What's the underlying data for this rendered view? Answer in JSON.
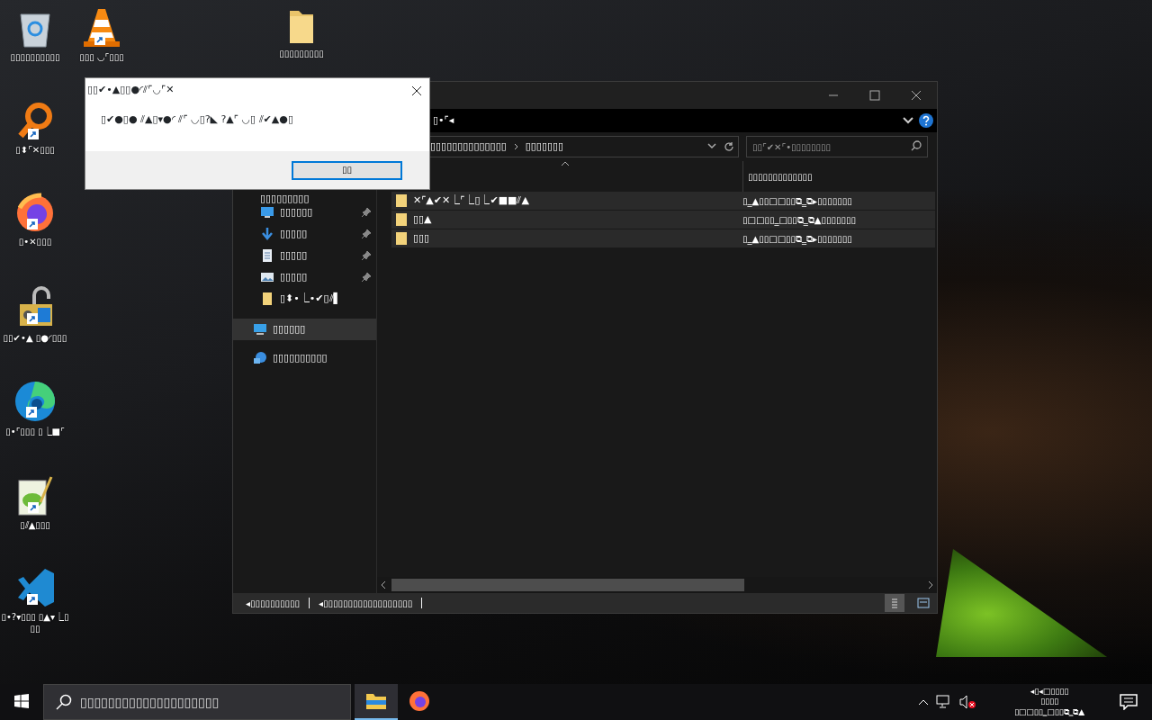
{
  "desktop_icons": [
    {
      "label": "▯▯▯▯▯▯▯▯▯▯",
      "kind": "recycle",
      "shortcut": false
    },
    {
      "label": "▯▯▯ ◡⌜▯▯▯",
      "kind": "cone",
      "shortcut": true
    },
    {
      "label": "▯▯▯▯▯▯▯▯▯",
      "kind": "folder",
      "shortcut": false
    },
    {
      "label": "▯⬍⌜✕▯▯▯",
      "kind": "magnifier",
      "shortcut": true
    },
    {
      "label": "▯•✕▯▯▯",
      "kind": "firefox",
      "shortcut": true
    },
    {
      "label": "▯▯✔•▲ ▯●◜▯▯▯",
      "kind": "lock",
      "shortcut": true
    },
    {
      "label": "▯•⌜▯▯▯ ▯⎿■⌜",
      "kind": "edge",
      "shortcut": true
    },
    {
      "label": "▯⫽▲▯▯▯",
      "kind": "notepad",
      "shortcut": true
    },
    {
      "label": "▯•?▾▯▯▯ ▯▲▾⎿▯▯▯",
      "kind": "vscode",
      "shortcut": true
    }
  ],
  "dialog": {
    "title": "▯▯✔•▲▯▯●◜⫽⌜◡⌜✕",
    "message": "▯✔●▯● ⫽▲▯▾●◜ ⫽⌜ ◡▯?◣ ?▲⌜ ◡▯ ⫽✔▲●▯",
    "button": "▯▯"
  },
  "explorer": {
    "ribbon_tab": "▯•⌜◂",
    "breadcrumb": [
      "▯▯▯▯▯▯▯▯▯▯▯▯▯▯",
      "▯▯▯▯▯▯▯"
    ],
    "search": {
      "placeholder": "▯▯⌜✔✕⌜•▯▯▯▯▯▯▯▯"
    },
    "nav_items": [
      {
        "label": "▯▯▯▯▯▯▯▯▯",
        "kind": "hidden",
        "pinned": false,
        "selected": false
      },
      {
        "label": "▯▯▯▯▯▯",
        "kind": "desktop",
        "pinned": true,
        "selected": false
      },
      {
        "label": "▯▯▯▯▯",
        "kind": "download",
        "pinned": true,
        "selected": false
      },
      {
        "label": "▯▯▯▯▯",
        "kind": "document",
        "pinned": true,
        "selected": false
      },
      {
        "label": "▯▯▯▯▯",
        "kind": "picture",
        "pinned": true,
        "selected": false
      },
      {
        "label": "▯⬍•⎿•✔▯⫽▌",
        "kind": "folder",
        "pinned": false,
        "selected": false
      },
      {
        "label": "▯▯▯▯▯▯",
        "kind": "computer",
        "pinned": false,
        "selected": true
      },
      {
        "label": "▯▯▯▯▯▯▯▯▯▯",
        "kind": "network",
        "pinned": false,
        "selected": false
      }
    ],
    "table": {
      "columns": [
        {
          "label": "▯▯▯▯▯▯▯▯▯▯▯▯▯"
        }
      ],
      "rows": [
        {
          "name": "✕⌜▲✔✕⎿⌜⎿▯⎿✔■■⫽▲",
          "date": "▯‗▲▯▯□□▯▯⧉‗⧉▸▯▯▯▯▯▯▯"
        },
        {
          "name": "▯▯▲",
          "date": "▯□□▯▯‗□▯▯⧉‗⧉▲▯▯▯▯▯▯▯"
        },
        {
          "name": "▯▯▯",
          "date": "▯‗▲▯▯□□▯▯⧉‗⧉▸▯▯▯▯▯▯▯"
        }
      ]
    },
    "status_bar": [
      "◂▯▯▯▯▯▯▯▯▯▯",
      "◂▯▯▯▯▯▯▯▯▯▯▯▯▯▯▯▯▯▯"
    ]
  },
  "taskbar": {
    "search": {
      "placeholder": "▯▯▯▯▯▯▯▯▯▯▯▯▯▯▯▯▯▯▯▯"
    },
    "apps": [
      {
        "kind": "explorer",
        "selected": true
      },
      {
        "kind": "firefox",
        "selected": false
      }
    ],
    "clock": [
      "◂▯◂□▯▯▯▯",
      "▯▯▯▯",
      "▯□□▯▯‗□▯▯⧉‗⧉▲"
    ]
  }
}
